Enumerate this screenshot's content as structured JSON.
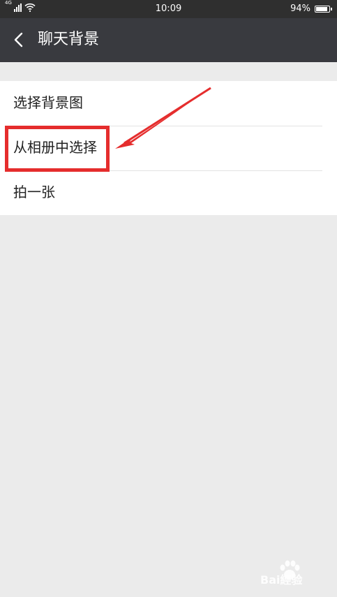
{
  "status_bar": {
    "network": "4G",
    "time": "10:09",
    "battery_percent": "94%",
    "battery_level": 0.94
  },
  "header": {
    "back_icon": "chevron-left-icon",
    "title": "聊天背景"
  },
  "menu": {
    "items": [
      {
        "label": "选择背景图"
      },
      {
        "label": "从相册中选择"
      },
      {
        "label": "拍一张"
      }
    ]
  },
  "annotation": {
    "highlight_color": "#e52d2d",
    "arrow_color": "#e52d2d"
  },
  "watermark": {
    "text": "Bai經验",
    "icon": "baidu-paw-icon"
  },
  "colors": {
    "status_bar_bg": "#2f2f2f",
    "header_bg": "#393a3f",
    "page_bg": "#ebebeb",
    "list_bg": "#ffffff"
  }
}
